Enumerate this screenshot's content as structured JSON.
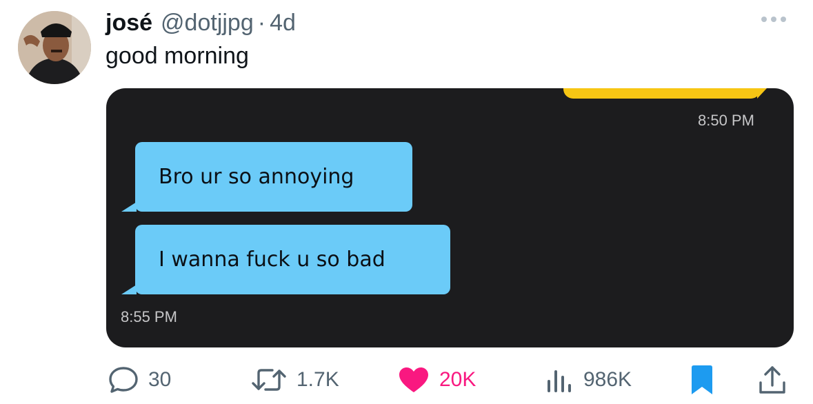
{
  "tweet": {
    "display_name": "josé",
    "handle": "@dotjjpg",
    "separator": "·",
    "age": "4d",
    "text": "good morning"
  },
  "media": {
    "screenshot_time_top": "8:50 PM",
    "messages": [
      "Bro ur so annoying",
      "I wanna fuck u so bad"
    ],
    "screenshot_time_bottom": "8:55 PM",
    "bubble_color": "#6bcbf8",
    "background_color": "#1c1c1e",
    "sent_bar_color": "#f7c614"
  },
  "actions": {
    "replies": "30",
    "retweets": "1.7K",
    "likes": "20K",
    "views": "986K",
    "liked": true,
    "bookmarked": true,
    "like_color": "#f91880",
    "bookmark_color": "#1d9bf0"
  }
}
